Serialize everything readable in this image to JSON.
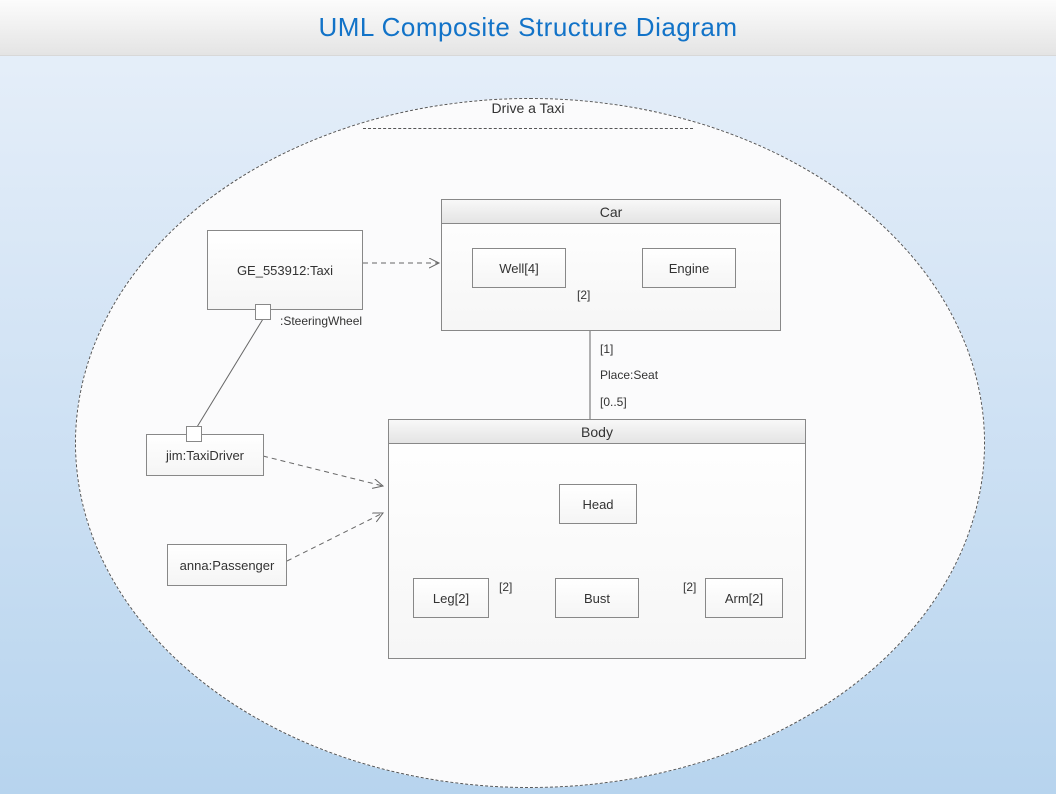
{
  "header": {
    "title": "UML Composite Structure Diagram"
  },
  "collaboration": {
    "label": "Drive a Taxi"
  },
  "nodes": {
    "taxi": "GE_553912:Taxi",
    "driver": "jim:TaxiDriver",
    "passenger": "anna:Passenger"
  },
  "car": {
    "title": "Car",
    "well": "Well[4]",
    "engine": "Engine",
    "well_engine_mult": "[2]"
  },
  "body": {
    "title": "Body",
    "head": "Head",
    "bust": "Bust",
    "leg": "Leg[2]",
    "arm": "Arm[2]",
    "leg_bust_mult": "[2]",
    "bust_arm_mult": "[2]"
  },
  "labels": {
    "steering_wheel": ":SteeringWheel",
    "seat": "Place:Seat",
    "car_side_mult": "[1]",
    "body_side_mult": "[0..5]"
  }
}
